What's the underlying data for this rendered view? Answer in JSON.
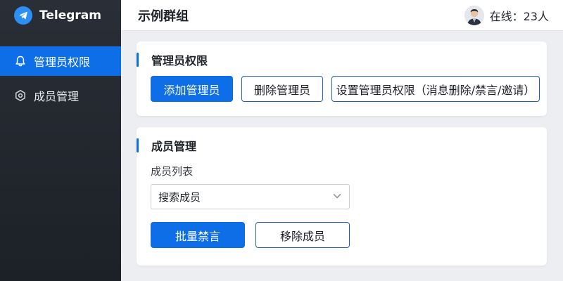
{
  "app": {
    "name": "Telegram"
  },
  "sidebar": {
    "items": [
      {
        "label": "管理员权限",
        "icon": "bell-icon",
        "active": true
      },
      {
        "label": "成员管理",
        "icon": "hexagon-settings-icon",
        "active": false
      }
    ]
  },
  "header": {
    "title": "示例群组",
    "online_text": "在线：23人"
  },
  "admin_card": {
    "title": "管理员权限",
    "buttons": {
      "add": "添加管理员",
      "remove": "删除管理员",
      "set": "设置管理员权限（消息删除/禁言/邀请）"
    }
  },
  "member_card": {
    "title": "成员管理",
    "list_label": "成员列表",
    "select_value": "搜索成员",
    "buttons": {
      "mute": "批量禁言",
      "remove": "移除成员"
    }
  },
  "colors": {
    "accent": "#0d6ee8",
    "sidebar_bg": "#23272e",
    "page_bg": "#eceef2"
  }
}
